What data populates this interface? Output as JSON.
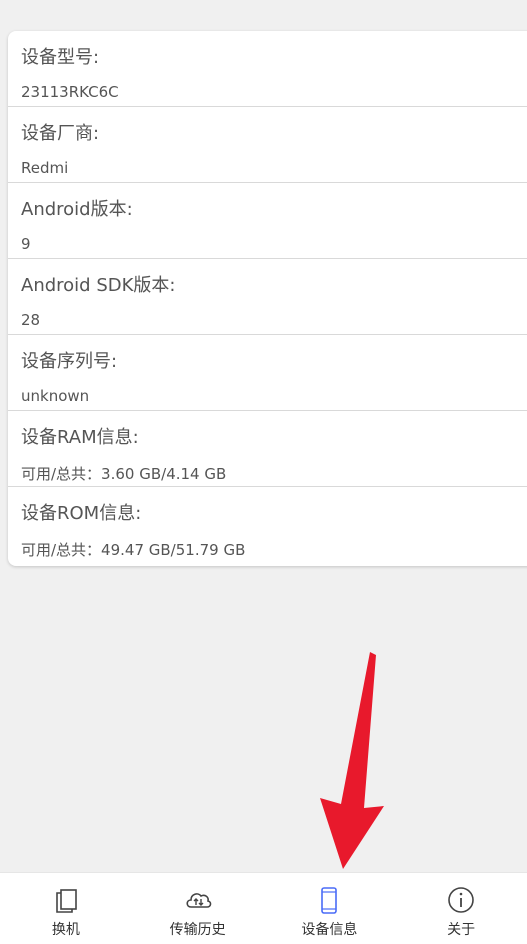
{
  "device_info": {
    "rows": [
      {
        "label": "设备型号:",
        "value": "23113RKC6C"
      },
      {
        "label": "设备厂商:",
        "value": "Redmi"
      },
      {
        "label": "Android版本:",
        "value": "9"
      },
      {
        "label": "Android SDK版本:",
        "value": "28"
      },
      {
        "label": "设备序列号:",
        "value": "unknown"
      },
      {
        "label": "设备RAM信息:",
        "value": "可用/总共：3.60 GB/4.14 GB"
      },
      {
        "label": "设备ROM信息:",
        "value": "可用/总共：49.47 GB/51.79 GB"
      }
    ]
  },
  "bottom_nav": {
    "items": [
      {
        "label": "换机",
        "icon": "copy-icon"
      },
      {
        "label": "传输历史",
        "icon": "cloud-transfer-icon"
      },
      {
        "label": "设备信息",
        "icon": "phone-icon",
        "active": true
      },
      {
        "label": "关于",
        "icon": "info-icon"
      }
    ]
  },
  "colors": {
    "background": "#f0f0f0",
    "card": "#ffffff",
    "text": "#555555",
    "active_icon": "#4a6cf7",
    "arrow": "#e8192c"
  }
}
